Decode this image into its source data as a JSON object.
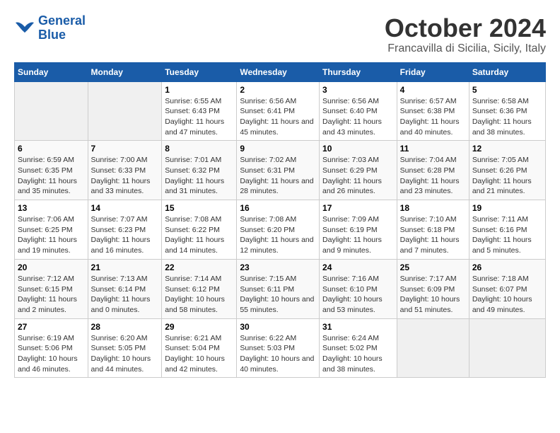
{
  "header": {
    "logo_line1": "General",
    "logo_line2": "Blue",
    "month_title": "October 2024",
    "location": "Francavilla di Sicilia, Sicily, Italy"
  },
  "days_of_week": [
    "Sunday",
    "Monday",
    "Tuesday",
    "Wednesday",
    "Thursday",
    "Friday",
    "Saturday"
  ],
  "weeks": [
    [
      {
        "day": "",
        "info": ""
      },
      {
        "day": "",
        "info": ""
      },
      {
        "day": "1",
        "info": "Sunrise: 6:55 AM\nSunset: 6:43 PM\nDaylight: 11 hours and 47 minutes."
      },
      {
        "day": "2",
        "info": "Sunrise: 6:56 AM\nSunset: 6:41 PM\nDaylight: 11 hours and 45 minutes."
      },
      {
        "day": "3",
        "info": "Sunrise: 6:56 AM\nSunset: 6:40 PM\nDaylight: 11 hours and 43 minutes."
      },
      {
        "day": "4",
        "info": "Sunrise: 6:57 AM\nSunset: 6:38 PM\nDaylight: 11 hours and 40 minutes."
      },
      {
        "day": "5",
        "info": "Sunrise: 6:58 AM\nSunset: 6:36 PM\nDaylight: 11 hours and 38 minutes."
      }
    ],
    [
      {
        "day": "6",
        "info": "Sunrise: 6:59 AM\nSunset: 6:35 PM\nDaylight: 11 hours and 35 minutes."
      },
      {
        "day": "7",
        "info": "Sunrise: 7:00 AM\nSunset: 6:33 PM\nDaylight: 11 hours and 33 minutes."
      },
      {
        "day": "8",
        "info": "Sunrise: 7:01 AM\nSunset: 6:32 PM\nDaylight: 11 hours and 31 minutes."
      },
      {
        "day": "9",
        "info": "Sunrise: 7:02 AM\nSunset: 6:31 PM\nDaylight: 11 hours and 28 minutes."
      },
      {
        "day": "10",
        "info": "Sunrise: 7:03 AM\nSunset: 6:29 PM\nDaylight: 11 hours and 26 minutes."
      },
      {
        "day": "11",
        "info": "Sunrise: 7:04 AM\nSunset: 6:28 PM\nDaylight: 11 hours and 23 minutes."
      },
      {
        "day": "12",
        "info": "Sunrise: 7:05 AM\nSunset: 6:26 PM\nDaylight: 11 hours and 21 minutes."
      }
    ],
    [
      {
        "day": "13",
        "info": "Sunrise: 7:06 AM\nSunset: 6:25 PM\nDaylight: 11 hours and 19 minutes."
      },
      {
        "day": "14",
        "info": "Sunrise: 7:07 AM\nSunset: 6:23 PM\nDaylight: 11 hours and 16 minutes."
      },
      {
        "day": "15",
        "info": "Sunrise: 7:08 AM\nSunset: 6:22 PM\nDaylight: 11 hours and 14 minutes."
      },
      {
        "day": "16",
        "info": "Sunrise: 7:08 AM\nSunset: 6:20 PM\nDaylight: 11 hours and 12 minutes."
      },
      {
        "day": "17",
        "info": "Sunrise: 7:09 AM\nSunset: 6:19 PM\nDaylight: 11 hours and 9 minutes."
      },
      {
        "day": "18",
        "info": "Sunrise: 7:10 AM\nSunset: 6:18 PM\nDaylight: 11 hours and 7 minutes."
      },
      {
        "day": "19",
        "info": "Sunrise: 7:11 AM\nSunset: 6:16 PM\nDaylight: 11 hours and 5 minutes."
      }
    ],
    [
      {
        "day": "20",
        "info": "Sunrise: 7:12 AM\nSunset: 6:15 PM\nDaylight: 11 hours and 2 minutes."
      },
      {
        "day": "21",
        "info": "Sunrise: 7:13 AM\nSunset: 6:14 PM\nDaylight: 11 hours and 0 minutes."
      },
      {
        "day": "22",
        "info": "Sunrise: 7:14 AM\nSunset: 6:12 PM\nDaylight: 10 hours and 58 minutes."
      },
      {
        "day": "23",
        "info": "Sunrise: 7:15 AM\nSunset: 6:11 PM\nDaylight: 10 hours and 55 minutes."
      },
      {
        "day": "24",
        "info": "Sunrise: 7:16 AM\nSunset: 6:10 PM\nDaylight: 10 hours and 53 minutes."
      },
      {
        "day": "25",
        "info": "Sunrise: 7:17 AM\nSunset: 6:09 PM\nDaylight: 10 hours and 51 minutes."
      },
      {
        "day": "26",
        "info": "Sunrise: 7:18 AM\nSunset: 6:07 PM\nDaylight: 10 hours and 49 minutes."
      }
    ],
    [
      {
        "day": "27",
        "info": "Sunrise: 6:19 AM\nSunset: 5:06 PM\nDaylight: 10 hours and 46 minutes."
      },
      {
        "day": "28",
        "info": "Sunrise: 6:20 AM\nSunset: 5:05 PM\nDaylight: 10 hours and 44 minutes."
      },
      {
        "day": "29",
        "info": "Sunrise: 6:21 AM\nSunset: 5:04 PM\nDaylight: 10 hours and 42 minutes."
      },
      {
        "day": "30",
        "info": "Sunrise: 6:22 AM\nSunset: 5:03 PM\nDaylight: 10 hours and 40 minutes."
      },
      {
        "day": "31",
        "info": "Sunrise: 6:24 AM\nSunset: 5:02 PM\nDaylight: 10 hours and 38 minutes."
      },
      {
        "day": "",
        "info": ""
      },
      {
        "day": "",
        "info": ""
      }
    ]
  ]
}
